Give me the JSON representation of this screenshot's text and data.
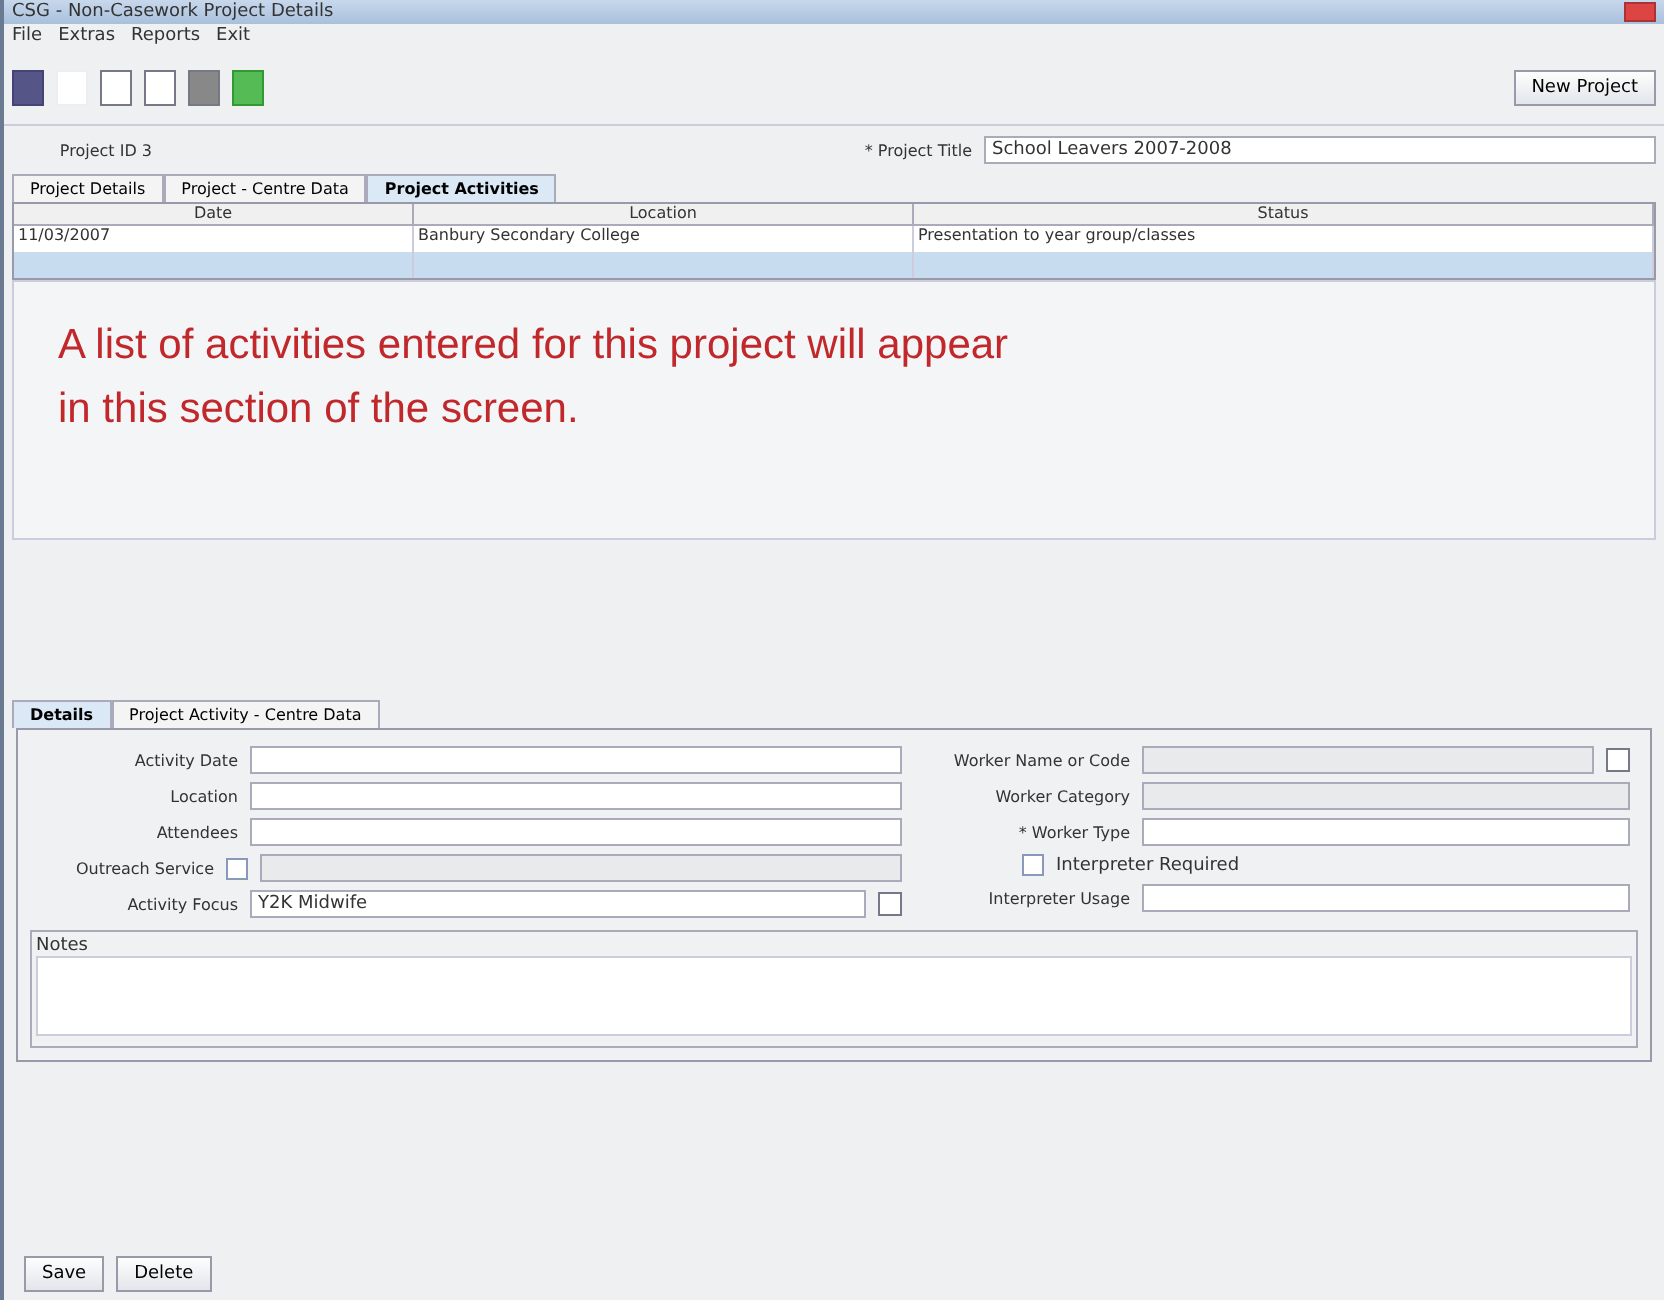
{
  "window": {
    "title": "CSG - Non-Casework Project Details"
  },
  "menu": [
    "File",
    "Extras",
    "Reports",
    "Exit"
  ],
  "toolbar": {
    "new_button": "New Project"
  },
  "project": {
    "id_label": "Project ID 3",
    "title_label": "* Project Title",
    "title_value": "School Leavers 2007-2008"
  },
  "tabs": [
    {
      "label": "Project Details",
      "selected": false
    },
    {
      "label": "Project - Centre Data",
      "selected": false
    },
    {
      "label": "Project Activities",
      "selected": true
    }
  ],
  "table": {
    "columns": [
      "Date",
      "Location",
      "Status"
    ],
    "rows": [
      {
        "cells": [
          "11/03/2007",
          "Banbury Secondary College",
          "Presentation to year group/classes"
        ],
        "selected": false
      },
      {
        "cells": [
          "",
          "",
          ""
        ],
        "selected": true
      }
    ]
  },
  "annotation": "A list of activities entered for this project will appear in this section of the screen.",
  "detail_tabs": [
    {
      "label": "Details",
      "selected": true
    },
    {
      "label": "Project Activity - Centre Data",
      "selected": false
    }
  ],
  "details": {
    "activity_date": "Activity Date",
    "location": "Location",
    "attendees": "Attendees",
    "outreach": {
      "label": "Outreach Service",
      "checked": false
    },
    "activity_focus": {
      "label": "Activity Focus",
      "value": "Y2K Midwife"
    },
    "worker_name": "Worker Name or Code",
    "worker_category": "Worker Category",
    "worker_type": "* Worker Type",
    "interpreter": {
      "label": "Interpreter Required",
      "checked": false
    },
    "interpreter_usage": "Interpreter Usage",
    "notes": "Notes"
  },
  "buttons": [
    "Save",
    "Delete"
  ]
}
